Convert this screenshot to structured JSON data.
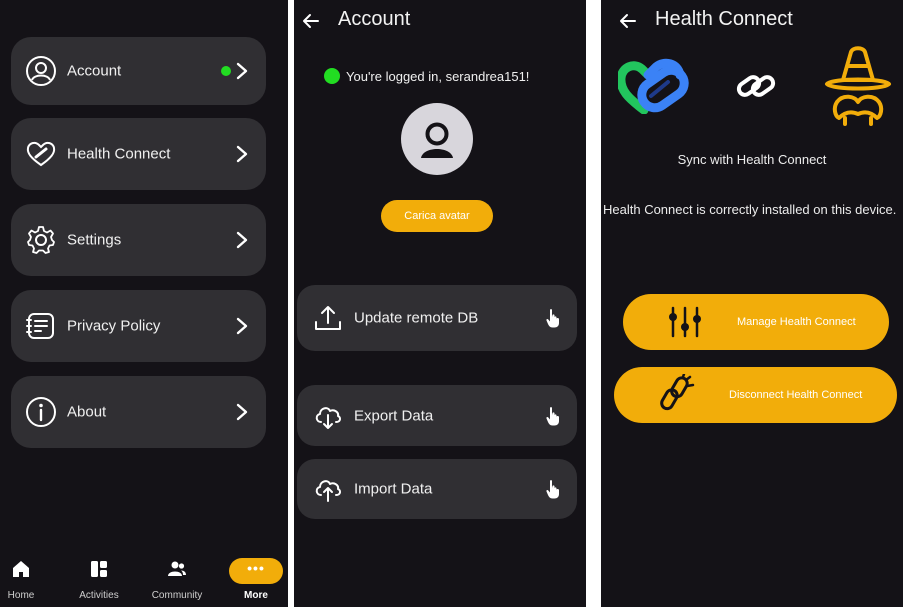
{
  "more_screen": {
    "menu": [
      {
        "label": "Account",
        "icon": "user-circle-icon",
        "status": "online"
      },
      {
        "label": "Health Connect",
        "icon": "heart-link-icon"
      },
      {
        "label": "Settings",
        "icon": "gear-icon"
      },
      {
        "label": "Privacy Policy",
        "icon": "privacy-doc-icon"
      },
      {
        "label": "About",
        "icon": "info-icon"
      }
    ],
    "bottom_nav": [
      {
        "label": "Home",
        "icon": "home-icon"
      },
      {
        "label": "Activities",
        "icon": "activities-icon"
      },
      {
        "label": "Community",
        "icon": "community-icon"
      },
      {
        "label": "More",
        "icon": "more-dots-icon",
        "active": true,
        "glyph": "•••"
      }
    ]
  },
  "account_screen": {
    "title": "Account",
    "logged_in_text": "You're logged in, serandrea151!",
    "upload_avatar_label": "Carica avatar",
    "actions": [
      {
        "label": "Update remote DB",
        "icon": "upload-icon"
      },
      {
        "label": "Export Data",
        "icon": "cloud-download-icon"
      },
      {
        "label": "Import Data",
        "icon": "cloud-upload-icon"
      }
    ]
  },
  "health_connect_screen": {
    "title": "Health Connect",
    "sync_label": "Sync with Health Connect",
    "description": "Health Connect is correctly installed on this device.",
    "manage_label": "Manage Health Connect",
    "disconnect_label": "Disconnect Health Connect"
  },
  "colors": {
    "background": "#141217",
    "card": "#302f33",
    "accent": "#f2ad0a",
    "online": "#22dd22"
  }
}
